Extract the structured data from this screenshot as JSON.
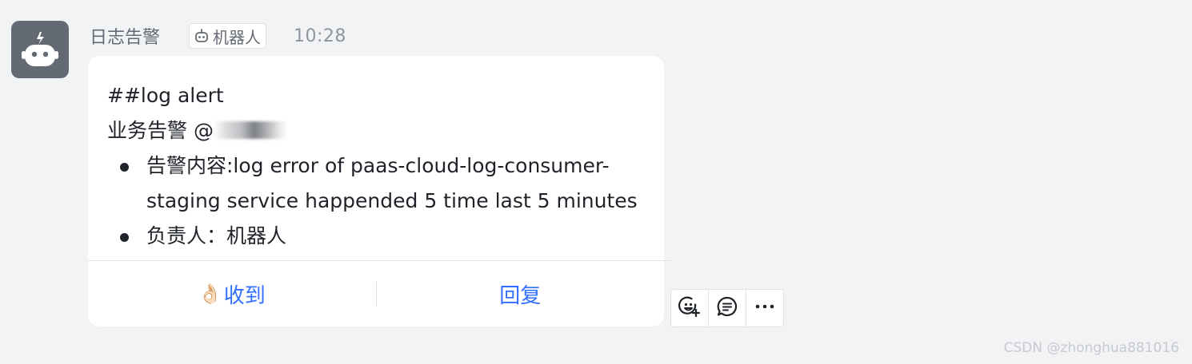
{
  "message": {
    "sender_name": "日志告警",
    "bot_tag_label": "机器人",
    "time": "10:28",
    "avatar_icon": "robot-icon"
  },
  "card": {
    "title_line": "##log alert",
    "mention_line": "业务告警 @",
    "bullets": [
      {
        "line1": "告警内容:log error of paas-cloud-log-consumer-",
        "line2": "staging service happended 5 time last 5 minutes"
      },
      {
        "line1": "负责人：机器人"
      }
    ],
    "actions": {
      "ack_emoji": "👌🏻",
      "ack_label": "收到",
      "reply_label": "回复"
    }
  },
  "toolbar": {
    "icons": [
      "emoji-add-icon",
      "reply-bubble-icon",
      "more-icon"
    ]
  },
  "watermark": "CSDN @zhonghua881016",
  "colors": {
    "background": "#f2f3f5",
    "card": "#ffffff",
    "accent": "#3370ff",
    "avatar": "#646a73",
    "text": "#1f2329"
  }
}
